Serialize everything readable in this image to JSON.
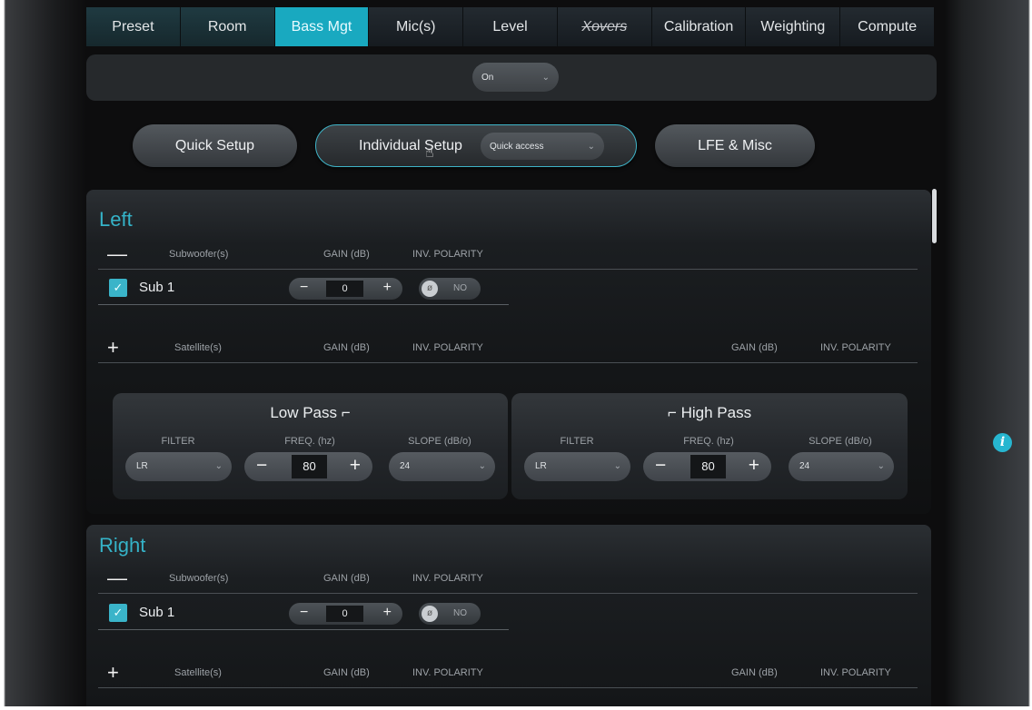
{
  "tabs": [
    {
      "label": "Preset"
    },
    {
      "label": "Room"
    },
    {
      "label": "Bass Mgt",
      "active": true
    },
    {
      "label": "Mic(s)"
    },
    {
      "label": "Level"
    },
    {
      "label": "Xovers",
      "struck": true
    },
    {
      "label": "Calibration"
    },
    {
      "label": "Weighting"
    },
    {
      "label": "Compute"
    }
  ],
  "bass_mode": {
    "value": "On"
  },
  "setup": {
    "quick": "Quick Setup",
    "individual": "Individual Setup",
    "quick_access": "Quick access",
    "lfe": "LFE & Misc"
  },
  "headers": {
    "subwoofers": "Subwoofer(s)",
    "satellites": "Satellite(s)",
    "gain": "GAIN (dB)",
    "polarity": "INV. POLARITY",
    "minus_symbol": "—",
    "plus_symbol": "+"
  },
  "channels": {
    "left": {
      "name": "Left",
      "sub": {
        "label": "Sub 1",
        "checked": true,
        "gain": "0",
        "polarity": "NO"
      },
      "low_pass": {
        "title": "Low Pass",
        "filter": "LR",
        "freq": "80",
        "slope": "24"
      },
      "high_pass": {
        "title": "High Pass",
        "filter": "LR",
        "freq": "80",
        "slope": "24"
      }
    },
    "right": {
      "name": "Right",
      "sub": {
        "label": "Sub 1",
        "checked": true,
        "gain": "0",
        "polarity": "NO"
      }
    }
  },
  "filter_labels": {
    "filter": "FILTER",
    "freq": "FREQ. (hz)",
    "slope": "SLOPE (dB/o)"
  },
  "colors": {
    "accent": "#19a9c0",
    "background": "#0d0d0e",
    "panel": "#1b1e21"
  },
  "icons": {
    "info": "info-icon",
    "check": "checkbox-checked-icon",
    "chevron": "chevron-down-icon"
  }
}
